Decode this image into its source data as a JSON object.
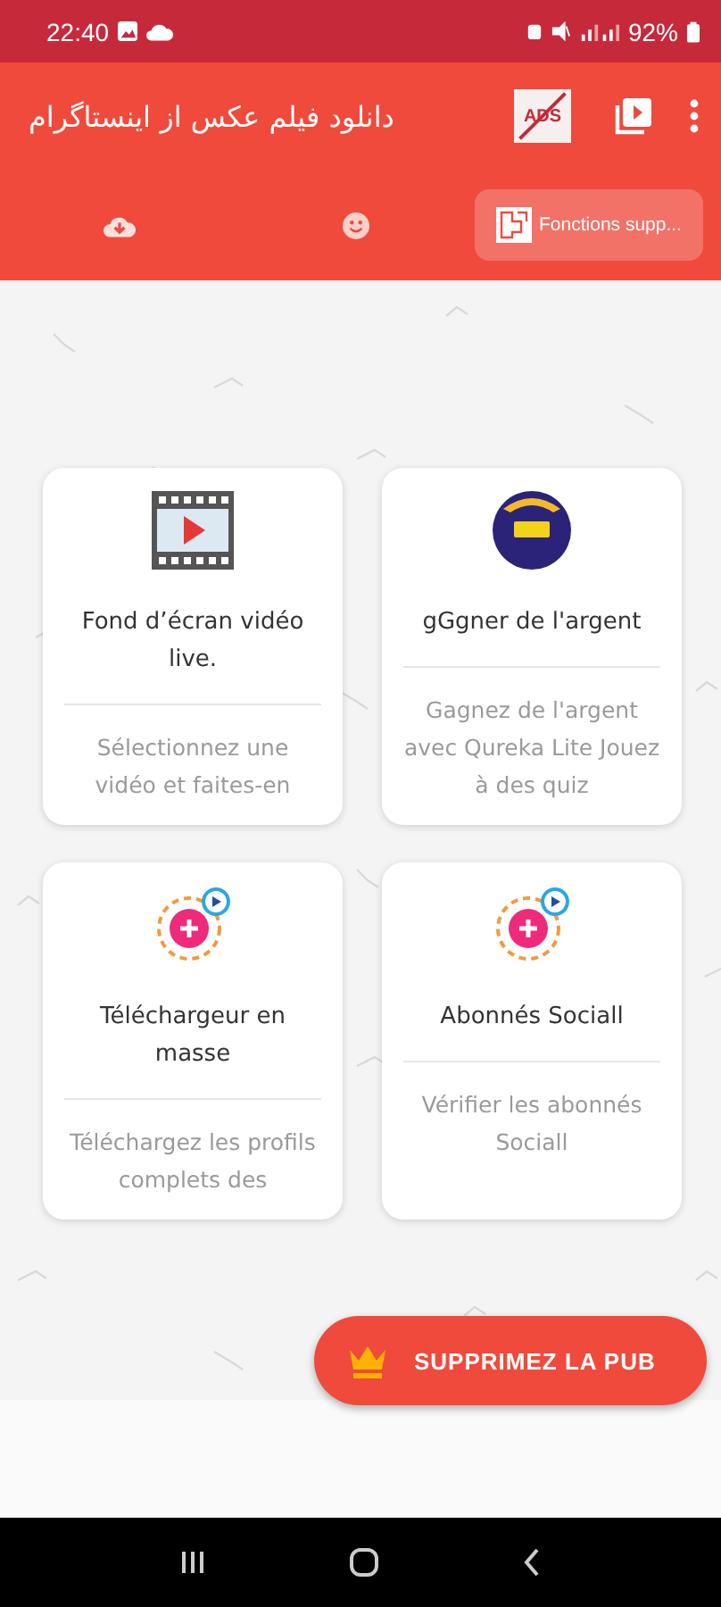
{
  "status_bar": {
    "time": "22:40",
    "battery": "92%"
  },
  "toolbar": {
    "title": "دانلود فیلم عکس از اینستاگرام",
    "ads_label": "ADS"
  },
  "tabs": [
    {
      "kind": "download",
      "selected": false
    },
    {
      "kind": "emoji",
      "selected": false
    },
    {
      "kind": "features",
      "label": "Fonctions supp...",
      "selected": true
    }
  ],
  "cards": [
    {
      "kind": "film",
      "title": "Fond d’écran vidéo live.",
      "description": "Sélectionnez une vidéo et faites-en"
    },
    {
      "kind": "coins",
      "title": "gGgner de l'argent",
      "description": "Gagnez de l'argent avec Qureka Lite Jouez à des quiz"
    },
    {
      "kind": "plus",
      "title": "Téléchargeur en masse",
      "description": "Téléchargez les profils complets des"
    },
    {
      "kind": "plus",
      "title": "Abonnés Sociall",
      "description": "Vérifier les abonnés Sociall"
    }
  ],
  "remove_ads_button": {
    "label": "SUPPRIMEZ LA PUB"
  }
}
